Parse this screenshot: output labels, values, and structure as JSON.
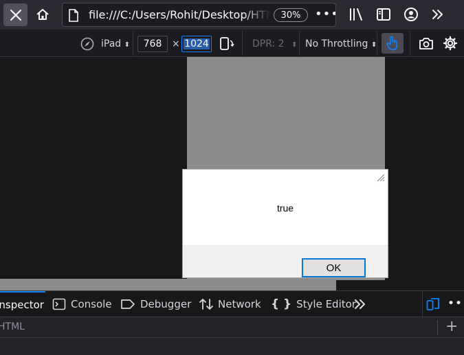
{
  "navbar": {
    "url": "file:///C:/Users/Rohit/Desktop/HTML",
    "zoom": "30%",
    "more": "•••"
  },
  "rdm": {
    "device": "iPad",
    "width": "768",
    "times": "×",
    "height": "1024",
    "dpr": "DPR: 2",
    "throttling": "No Throttling"
  },
  "dialog": {
    "message": "true",
    "ok_label": "OK"
  },
  "devtools": {
    "tabs": [
      {
        "label": "Inspector"
      },
      {
        "label": "Console"
      },
      {
        "label": "Debugger"
      },
      {
        "label": "Network"
      },
      {
        "label": "Style Editor"
      }
    ],
    "sub_label": "HTML",
    "plus": "+"
  },
  "colors": {
    "accent": "#0a84ff",
    "toolbar": "#2b2a33",
    "viewport_gray": "#8c8c8c"
  }
}
